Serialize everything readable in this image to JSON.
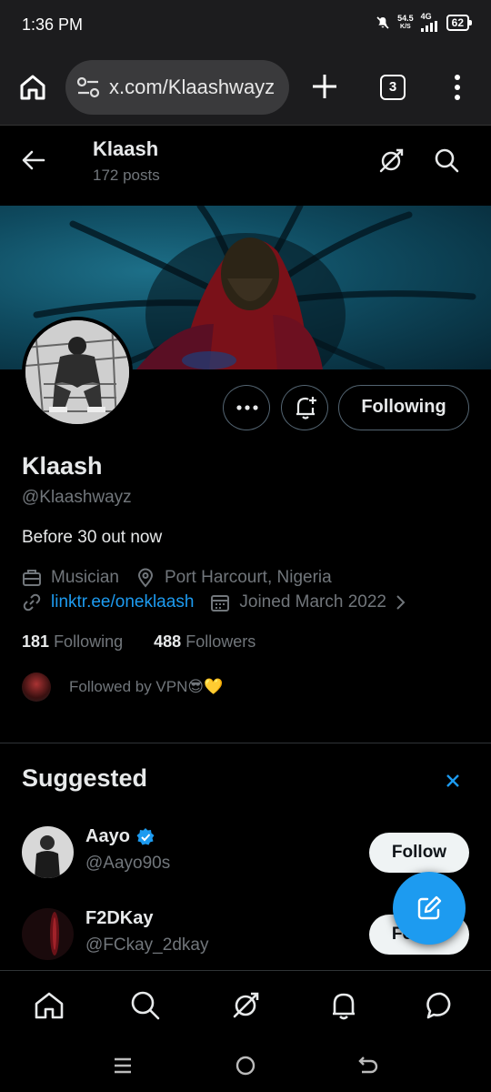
{
  "status_bar": {
    "time": "1:36 PM",
    "net_speed_value": "54.5",
    "net_speed_unit": "K/S",
    "network_type": "4G",
    "battery": "62"
  },
  "browser": {
    "url": "x.com/Klaashwayz",
    "tab_count": "3"
  },
  "header": {
    "name": "Klaash",
    "posts": "172 posts"
  },
  "profile": {
    "name": "Klaash",
    "handle": "@Klaashwayz",
    "bio": "Before 30 out now",
    "occupation": "Musician",
    "location": "Port Harcourt, Nigeria",
    "link": "linktr.ee/oneklaash",
    "joined": "Joined March 2022",
    "following_count": "181",
    "following_label": "Following",
    "followers_count": "488",
    "followers_label": "Followers",
    "followed_by": "Followed by VPN😎💛",
    "following_button": "Following"
  },
  "suggested": {
    "title": "Suggested",
    "items": [
      {
        "name": "Aayo",
        "handle": "@Aayo90s",
        "verified": true,
        "button": "Follow"
      },
      {
        "name": "F2DKay",
        "handle": "@FCkay_2dkay",
        "verified": false,
        "button": "Follow"
      }
    ]
  },
  "colors": {
    "accent": "#1d9bf0",
    "background": "#000000",
    "muted_text": "#71767b",
    "primary_text": "#e7e9ea"
  }
}
